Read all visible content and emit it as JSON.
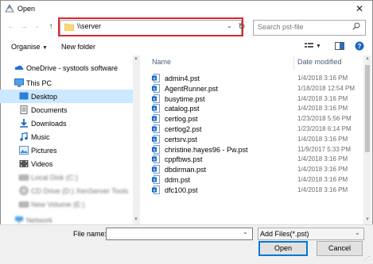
{
  "window": {
    "title": "Open",
    "close_glyph": "✕"
  },
  "address": {
    "value": "\\\\server"
  },
  "search": {
    "placeholder": "Search pst-file"
  },
  "toolbar": {
    "organise": "Organise",
    "new_folder": "New folder"
  },
  "nav": {
    "items": [
      {
        "label": "OneDrive - systools software",
        "icon": "onedrive-icon"
      },
      {
        "label": "This PC",
        "icon": "pc-icon"
      },
      {
        "label": "Desktop",
        "icon": "desktop-icon",
        "selected": true
      },
      {
        "label": "Documents",
        "icon": "documents-icon"
      },
      {
        "label": "Downloads",
        "icon": "downloads-icon"
      },
      {
        "label": "Music",
        "icon": "music-icon"
      },
      {
        "label": "Pictures",
        "icon": "pictures-icon"
      },
      {
        "label": "Videos",
        "icon": "videos-icon"
      },
      {
        "label": "Local Disk (C:)",
        "icon": "disk-icon",
        "blurred": true
      },
      {
        "label": "CD Drive (D:) XenServer Tools",
        "icon": "cd-icon",
        "blurred": true
      },
      {
        "label": "New Volume (E:)",
        "icon": "disk-icon",
        "blurred": true
      },
      {
        "label": "Network",
        "icon": "network-icon",
        "blurred": true
      }
    ]
  },
  "files": {
    "header": {
      "name": "Name",
      "date": "Date modified"
    },
    "rows": [
      {
        "name": "admin4.pst",
        "date": "1/4/2018 3:16 PM"
      },
      {
        "name": "AgentRunner.pst",
        "date": "1/18/2018 12:54 PM"
      },
      {
        "name": "busytime.pst",
        "date": "1/4/2018 3:16 PM"
      },
      {
        "name": "catalog.pst",
        "date": "1/4/2018 3:16 PM"
      },
      {
        "name": "certlog.pst",
        "date": "1/23/2018 5:56 PM"
      },
      {
        "name": "certlog2.pst",
        "date": "1/23/2018 6:14 PM"
      },
      {
        "name": "certsrv.pst",
        "date": "1/4/2018 3:16 PM"
      },
      {
        "name": "christine.hayes96 - Pw.pst",
        "date": "11/9/2017 5:33 PM"
      },
      {
        "name": "cppfbws.pst",
        "date": "1/4/2018 3:16 PM"
      },
      {
        "name": "dbdirman.pst",
        "date": "1/4/2018 3:16 PM"
      },
      {
        "name": "ddm.pst",
        "date": "1/4/2018 3:16 PM"
      },
      {
        "name": "dfc100.pst",
        "date": "1/4/2018 3:16 PM"
      }
    ]
  },
  "bottom": {
    "file_name_label": "File name:",
    "file_name_value": "",
    "filter_value": "Add Files(*.pst)",
    "open_label": "Open",
    "cancel_label": "Cancel"
  },
  "colors": {
    "highlight": "#e0262b",
    "selection": "#cce8ff",
    "accent": "#0078d7"
  }
}
